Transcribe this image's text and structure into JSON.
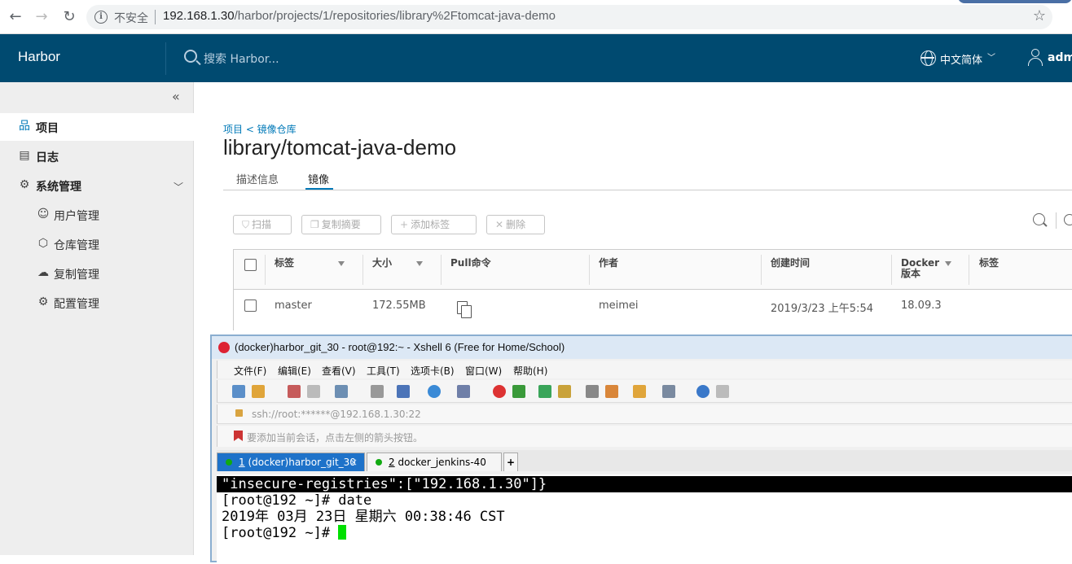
{
  "browser": {
    "insecure_label": "不安全",
    "url_host": "192.168.1.30",
    "url_path": "/harbor/projects/1/repositories/library%2Ftomcat-java-demo"
  },
  "header": {
    "brand": "Harbor",
    "search_placeholder": "搜索 Harbor...",
    "language": "中文简体",
    "user": "adm"
  },
  "sidebar": {
    "items": [
      {
        "label": "项目",
        "icon": "projects-icon"
      },
      {
        "label": "日志",
        "icon": "logs-icon"
      },
      {
        "label": "系统管理",
        "icon": "admin-icon"
      }
    ],
    "sub_items": [
      {
        "label": "用户管理",
        "icon": "users-icon"
      },
      {
        "label": "仓库管理",
        "icon": "registry-icon"
      },
      {
        "label": "复制管理",
        "icon": "replication-icon"
      },
      {
        "label": "配置管理",
        "icon": "config-icon"
      }
    ]
  },
  "main": {
    "breadcrumb": "项目 < 镜像仓库",
    "title": "library/tomcat-java-demo",
    "tabs": [
      "描述信息",
      "镜像"
    ],
    "toolbar": {
      "scan": "扫描",
      "copy_digest": "复制摘要",
      "add_label": "添加标签",
      "delete": "删除"
    },
    "table": {
      "headers": [
        "标签",
        "大小",
        "Pull命令",
        "作者",
        "创建时间",
        "Docker 版本",
        "标签"
      ],
      "docker_header_line1": "Docker",
      "docker_header_line2": "版本",
      "rows": [
        {
          "tag": "master",
          "size": "172.55MB",
          "author": "meimei",
          "created": "2019/3/23 上午5:54",
          "docker": "18.09.3"
        }
      ]
    }
  },
  "xshell": {
    "title": "(docker)harbor_git_30 - root@192:~ - Xshell 6 (Free for Home/School)",
    "menu": [
      "文件(F)",
      "编辑(E)",
      "查看(V)",
      "工具(T)",
      "选项卡(B)",
      "窗口(W)",
      "帮助(H)"
    ],
    "address": "ssh://root:******@192.168.1.30:22",
    "hint": "要添加当前会话，点击左侧的箭头按钮。",
    "tabs": [
      {
        "num": "1",
        "label": " (docker)harbor_git_30"
      },
      {
        "num": "2",
        "label": " docker_jenkins-40"
      }
    ],
    "terminal_lines": [
      "\"insecure-registries\":[\"192.168.1.30\"]}",
      "[root@192 ~]# date",
      "2019年 03月 23日 星期六 00:38:46 CST",
      "[root@192 ~]# "
    ]
  },
  "colors": {
    "header_bg": "#004a70",
    "accent": "#0079b8",
    "xshell_tab_active": "#1e72c9"
  }
}
